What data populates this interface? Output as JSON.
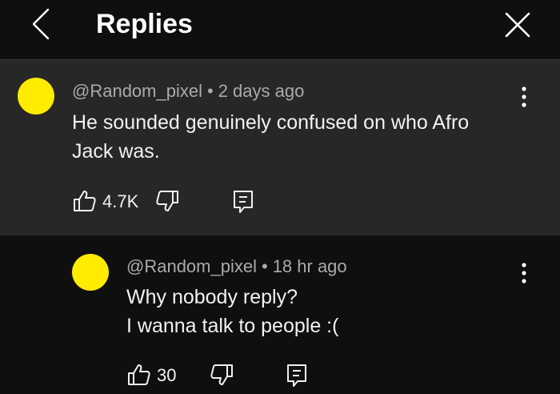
{
  "header": {
    "title": "Replies"
  },
  "comments": [
    {
      "author": "@Random_pixel",
      "separator": "•",
      "time": "2 days ago",
      "lines": [
        "He sounded genuinely confused on who Afro",
        "Jack was."
      ],
      "likes": "4.7K"
    },
    {
      "author": "@Random_pixel",
      "separator": "•",
      "time": "18 hr ago",
      "lines": [
        "Why nobody reply?",
        "I wanna talk to people :("
      ],
      "likes": "30"
    }
  ],
  "colors": {
    "background": "#0f0f0f",
    "parent_background": "#272727",
    "avatar": "#ffec00",
    "text": "#f1f1f1",
    "meta": "#aaaaaa"
  }
}
